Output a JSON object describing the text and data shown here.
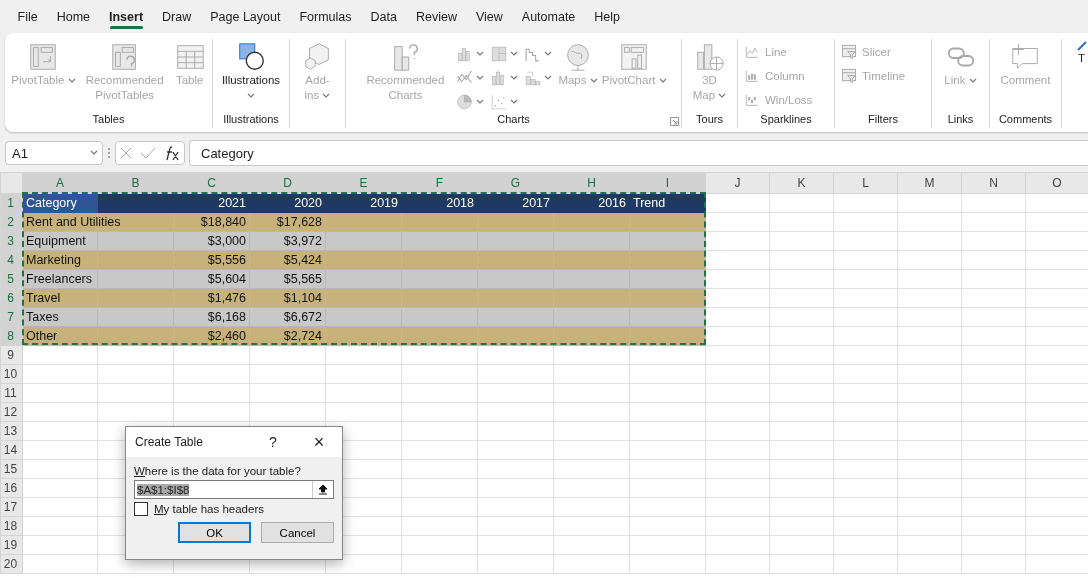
{
  "menu": [
    {
      "label": "File",
      "selected": false
    },
    {
      "label": "Home",
      "selected": false
    },
    {
      "label": "Insert",
      "selected": true
    },
    {
      "label": "Draw",
      "selected": false
    },
    {
      "label": "Page Layout",
      "selected": false
    },
    {
      "label": "Formulas",
      "selected": false
    },
    {
      "label": "Data",
      "selected": false
    },
    {
      "label": "Review",
      "selected": false
    },
    {
      "label": "View",
      "selected": false
    },
    {
      "label": "Automate",
      "selected": false
    },
    {
      "label": "Help",
      "selected": false
    }
  ],
  "ribbon": [
    {
      "label": "Tables",
      "items": [
        {
          "kind": "large",
          "label": "PivotTable",
          "disabled": true,
          "dropdown": true
        },
        {
          "kind": "large",
          "label": "Recommended PivotTables",
          "disabled": true,
          "dropdown": false
        },
        {
          "kind": "large",
          "label": "Table",
          "disabled": true,
          "dropdown": false
        }
      ]
    },
    {
      "label": "Illustrations",
      "items": [
        {
          "kind": "large",
          "label": "Illustrations",
          "disabled": false,
          "dropdown": true
        }
      ]
    },
    {
      "items": [
        {
          "kind": "large",
          "label": "Add-ins",
          "disabled": true,
          "dropdown": true
        }
      ]
    },
    {
      "label": "Charts",
      "launcher": true,
      "items": [
        {
          "kind": "large",
          "label": "Recommended Charts",
          "disabled": true,
          "dropdown": false
        },
        {
          "kind": "chart-icons",
          "disabled": true
        },
        {
          "kind": "large",
          "label": "Maps",
          "disabled": true,
          "dropdown": true
        },
        {
          "kind": "large",
          "label": "PivotChart",
          "disabled": true,
          "dropdown": true
        }
      ]
    },
    {
      "label": "Tours",
      "items": [
        {
          "kind": "large",
          "label": "3D Map",
          "disabled": true,
          "dropdown": true
        }
      ]
    },
    {
      "label": "Sparklines",
      "items": [
        {
          "kind": "small",
          "label": "Line",
          "disabled": true
        },
        {
          "kind": "small",
          "label": "Column",
          "disabled": true
        },
        {
          "kind": "small",
          "label": "Win/Loss",
          "disabled": true
        }
      ]
    },
    {
      "label": "Filters",
      "items": [
        {
          "kind": "small",
          "label": "Slicer",
          "disabled": true
        },
        {
          "kind": "small",
          "label": "Timeline",
          "disabled": true
        }
      ]
    },
    {
      "label": "Links",
      "items": [
        {
          "kind": "large",
          "label": "Link",
          "disabled": true,
          "dropdown": true
        }
      ]
    },
    {
      "label": "Comments",
      "items": [
        {
          "kind": "large",
          "label": "Comment",
          "disabled": true,
          "dropdown": false
        }
      ]
    },
    {
      "items": [
        {
          "kind": "large",
          "label": "T",
          "disabled": false,
          "dropdown": false
        }
      ]
    }
  ],
  "formula_bar": {
    "name_box": "A1",
    "formula": "Category"
  },
  "columns": [
    {
      "label": "A",
      "selected": true
    },
    {
      "label": "B",
      "selected": true
    },
    {
      "label": "C",
      "selected": true
    },
    {
      "label": "D",
      "selected": true
    },
    {
      "label": "E",
      "selected": true
    },
    {
      "label": "F",
      "selected": true
    },
    {
      "label": "G",
      "selected": true
    },
    {
      "label": "H",
      "selected": true
    },
    {
      "label": "I",
      "selected": true
    },
    {
      "label": "J",
      "selected": false
    },
    {
      "label": "K",
      "selected": false
    },
    {
      "label": "L",
      "selected": false
    },
    {
      "label": "M",
      "selected": false
    },
    {
      "label": "N",
      "selected": false
    },
    {
      "label": "O",
      "selected": false
    }
  ],
  "rows": [
    {
      "number": "1",
      "selected": true,
      "kind": "header",
      "cells": {
        "A": "Category",
        "C": "2021",
        "D": "2020",
        "E": "2019",
        "F": "2018",
        "G": "2017",
        "H": "2016",
        "I": "Trend"
      }
    },
    {
      "number": "2",
      "selected": true,
      "kind": "gold",
      "cells": {
        "A": "Rent and Utilities",
        "C": "$18,840",
        "D": "$17,628"
      }
    },
    {
      "number": "3",
      "selected": true,
      "kind": "gray",
      "cells": {
        "A": "Equipment",
        "C": "$3,000",
        "D": "$3,972"
      }
    },
    {
      "number": "4",
      "selected": true,
      "kind": "gold",
      "cells": {
        "A": "Marketing",
        "C": "$5,556",
        "D": "$5,424"
      }
    },
    {
      "number": "5",
      "selected": true,
      "kind": "gray",
      "cells": {
        "A": "Freelancers",
        "C": "$5,604",
        "D": "$5,565"
      }
    },
    {
      "number": "6",
      "selected": true,
      "kind": "gold",
      "cells": {
        "A": "Travel",
        "C": "$1,476",
        "D": "$1,104"
      }
    },
    {
      "number": "7",
      "selected": true,
      "kind": "gray",
      "cells": {
        "A": "Taxes",
        "C": "$6,168",
        "D": "$6,672"
      }
    },
    {
      "number": "8",
      "selected": true,
      "kind": "gold",
      "cells": {
        "A": "Other",
        "C": "$2,460",
        "D": "$2,724"
      }
    },
    {
      "number": "9",
      "selected": false,
      "kind": "plain"
    },
    {
      "number": "10",
      "selected": false,
      "kind": "plain"
    },
    {
      "number": "11",
      "selected": false,
      "kind": "plain"
    },
    {
      "number": "12",
      "selected": false,
      "kind": "plain"
    },
    {
      "number": "13",
      "selected": false,
      "kind": "plain"
    },
    {
      "number": "14",
      "selected": false,
      "kind": "plain"
    },
    {
      "number": "15",
      "selected": false,
      "kind": "plain"
    },
    {
      "number": "16",
      "selected": false,
      "kind": "plain"
    },
    {
      "number": "17",
      "selected": false,
      "kind": "plain"
    },
    {
      "number": "18",
      "selected": false,
      "kind": "plain"
    },
    {
      "number": "19",
      "selected": false,
      "kind": "plain"
    },
    {
      "number": "20",
      "selected": false,
      "kind": "plain"
    }
  ],
  "dialog": {
    "title": "Create Table",
    "help": "?",
    "close": "×",
    "prompt": "Where is the data for your table?",
    "range": "$A$1:$I$8",
    "headers_label": "My table has headers",
    "headers_checked": false,
    "buttons": [
      {
        "label": "OK",
        "default": true
      },
      {
        "label": "Cancel",
        "default": false
      }
    ]
  }
}
